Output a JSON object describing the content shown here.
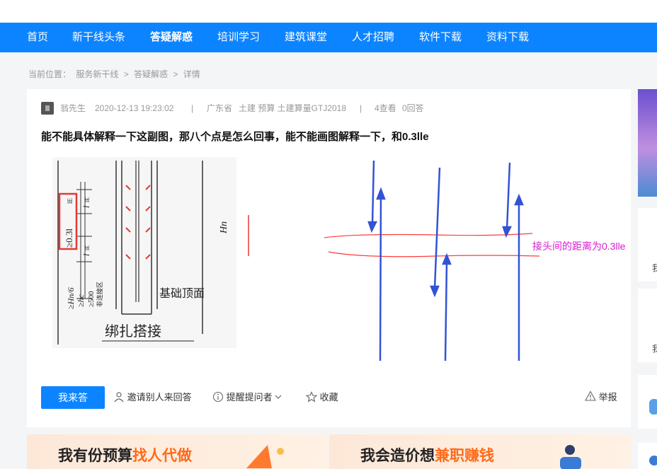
{
  "nav": {
    "items": [
      {
        "label": "首页",
        "active": false
      },
      {
        "label": "新干线头条",
        "active": false
      },
      {
        "label": "答疑解惑",
        "active": true
      },
      {
        "label": "培训学习",
        "active": false
      },
      {
        "label": "建筑课堂",
        "active": false
      },
      {
        "label": "人才招聘",
        "active": false
      },
      {
        "label": "软件下载",
        "active": false
      },
      {
        "label": "资料下载",
        "active": false
      }
    ]
  },
  "breadcrumb": {
    "prefix": "当前位置：",
    "items": [
      "服务新干线",
      "答疑解惑",
      "详情"
    ],
    "separator": ">"
  },
  "question": {
    "author": "翁先生",
    "datetime": "2020-12-13 19:23:02",
    "sep": "|",
    "region": "广东省",
    "tags": "土建 预算 土建算量GTJ2018",
    "views": "4查看",
    "answers": "0回答",
    "title": "能不能具体解释一下这副图，那八个点是怎么回事，能不能画图解释一下，和0.3lle"
  },
  "figure": {
    "label_left": "≥0.3l",
    "label_left_sub": "lE",
    "label_lle_top": "l",
    "label_lle_sub": "lE",
    "label_hn6": "≥Hn/6",
    "label_hc": "≥hc",
    "label_500": "≥500",
    "label_zone": "非连接区",
    "label_Hn": "Hn",
    "label_base": "基础顶面",
    "caption": "绑扎搭接",
    "annotation": "接头间的距离为0.3lle",
    "annotation_color": "#d81bd0"
  },
  "actions": {
    "answer": "我来答",
    "invite": "邀请别人来回答",
    "remind": "提醒提问者",
    "collect": "收藏",
    "report": "举报"
  },
  "banners": [
    {
      "text": "我有份预算",
      "highlight": "找人代做"
    },
    {
      "text": "我会造价想",
      "highlight": "兼职赚钱"
    }
  ],
  "sidebar": {
    "glyph": "我"
  },
  "colors": {
    "brand": "#0d84ff",
    "highlight": "#ff6a1a",
    "arrow": "#3253d6",
    "drawline": "#ff3a3a"
  }
}
